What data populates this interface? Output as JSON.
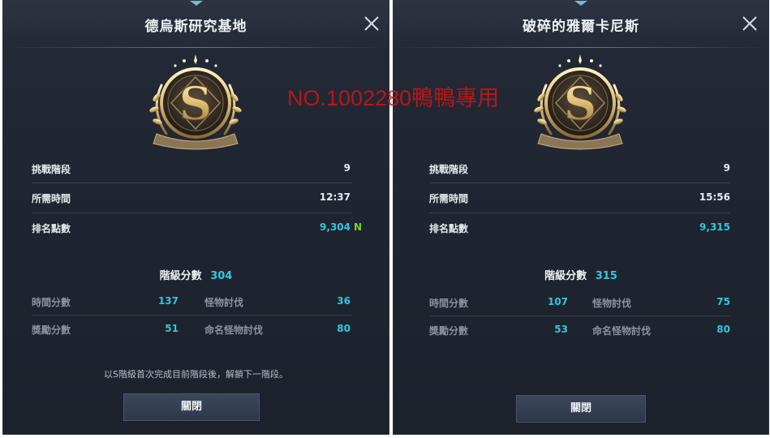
{
  "left_panel": {
    "title": "德烏斯研究基地",
    "emblem_letter": "S",
    "stats": [
      {
        "label": "挑戰階段",
        "value": "9"
      },
      {
        "label": "所需時間",
        "value": "12:37"
      },
      {
        "label": "排名點數",
        "value": "9,304"
      }
    ],
    "new_badge": "N",
    "grade_label": "階級分數",
    "grade_value": "304",
    "sub_scores": [
      {
        "label": "時間分數",
        "value": "137"
      },
      {
        "label": "怪物討伐",
        "value": "36"
      },
      {
        "label": "獎勵分數",
        "value": "51"
      },
      {
        "label": "命名怪物討伐",
        "value": "80"
      }
    ],
    "hint": "以S階級首次完成目前階段後，解鎖下一階段。",
    "close_button": "關閉"
  },
  "right_panel": {
    "title": "破碎的雅爾卡尼斯",
    "emblem_letter": "S",
    "stats": [
      {
        "label": "挑戰階段",
        "value": "9"
      },
      {
        "label": "所需時間",
        "value": "15:56"
      },
      {
        "label": "排名點數",
        "value": "9,315"
      }
    ],
    "grade_label": "階級分數",
    "grade_value": "315",
    "sub_scores": [
      {
        "label": "時間分數",
        "value": "107"
      },
      {
        "label": "怪物討伐",
        "value": "75"
      },
      {
        "label": "獎勵分數",
        "value": "53"
      },
      {
        "label": "命名怪物討伐",
        "value": "80"
      }
    ],
    "close_button": "關閉"
  },
  "watermark": "NO.1002280鴨鴨專用",
  "colors": {
    "accent_cyan": "#35c6e0",
    "new_badge_green": "#7bd12a",
    "watermark_red": "#d21414",
    "panel_bg": "#1f2530"
  },
  "icons": [
    "close-icon",
    "s-rank-emblem-icon",
    "top-gem-icon"
  ]
}
